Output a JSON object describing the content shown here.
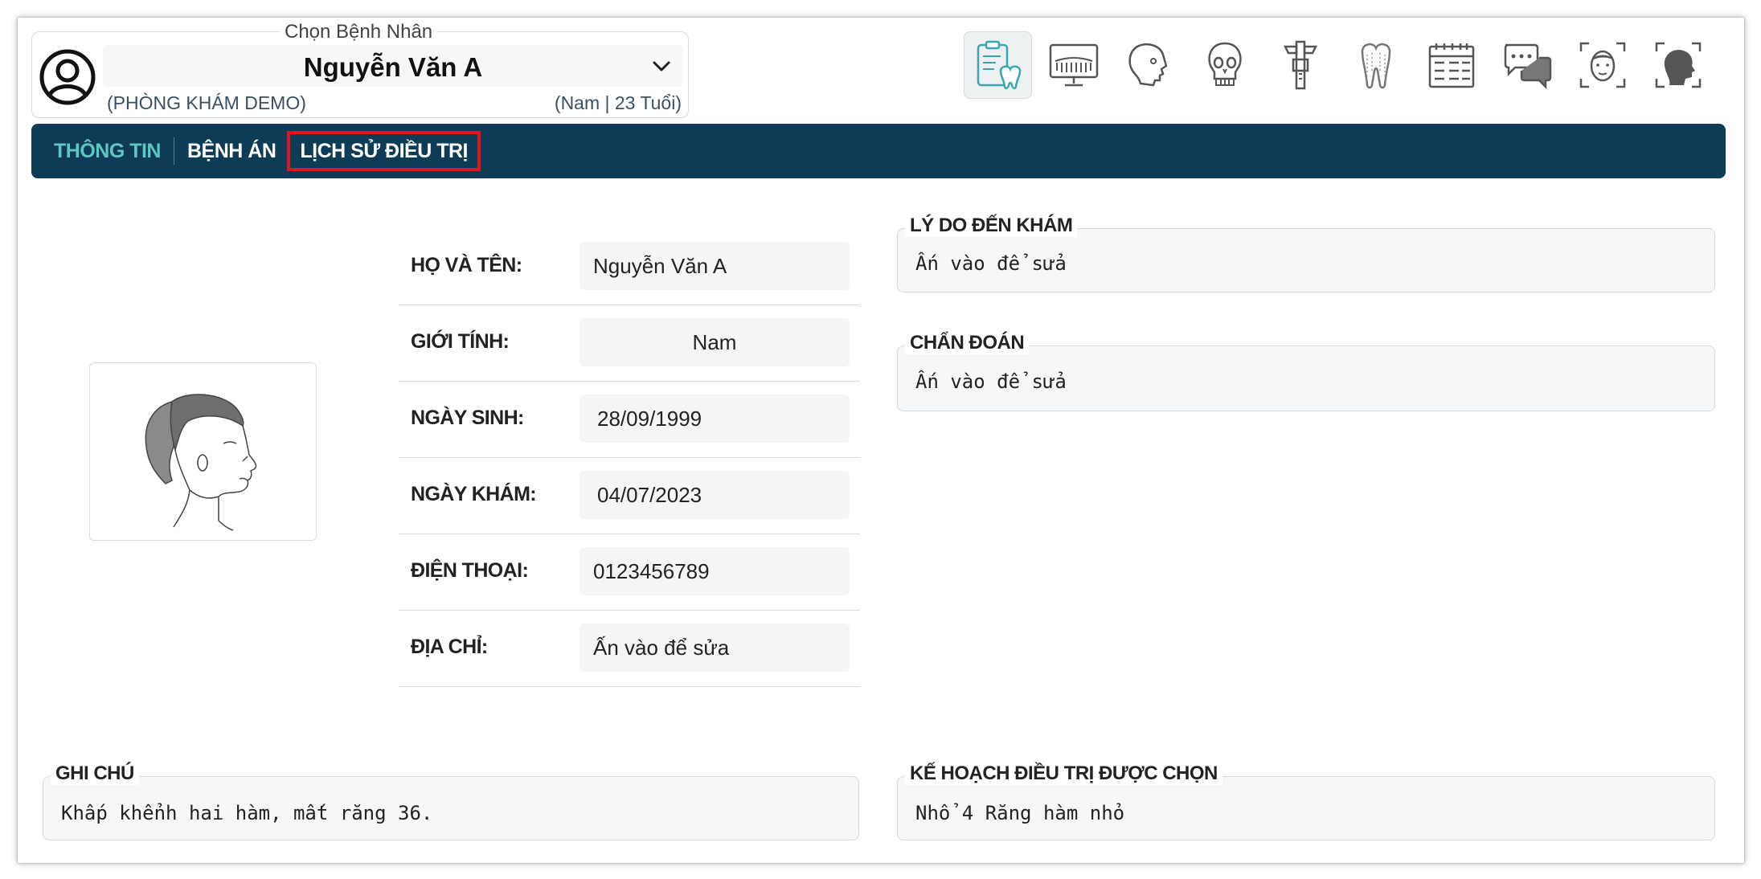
{
  "patient": {
    "legend": "Chọn Bệnh Nhân",
    "name": "Nguyễn Văn A",
    "clinic": "(PHÒNG KHÁM DEMO)",
    "meta": "(Nam | 23 Tuổi)"
  },
  "toolbar": {
    "tools": [
      {
        "icon": "clipboard-tooth-icon",
        "active": true
      },
      {
        "icon": "xray-monitor-icon",
        "active": false
      },
      {
        "icon": "skull-profile-icon",
        "active": false
      },
      {
        "icon": "skull-front-icon",
        "active": false
      },
      {
        "icon": "caliper-icon",
        "active": false
      },
      {
        "icon": "tooth-icon",
        "active": false
      },
      {
        "icon": "calendar-icon",
        "active": false
      },
      {
        "icon": "chat-icon",
        "active": false
      },
      {
        "icon": "face-scan-icon",
        "active": false
      },
      {
        "icon": "head-scan-icon",
        "active": false
      }
    ]
  },
  "tabs": {
    "info": "THÔNG TIN",
    "record": "BỆNH ÁN",
    "history": "LỊCH SỬ ĐIỀU TRỊ",
    "active": "info",
    "highlighted": "history",
    "colors": {
      "bar": "#0e3b56",
      "active": "#5fc7c3",
      "highlight": "#e3141b"
    }
  },
  "info": {
    "fullname_label": "HỌ VÀ TÊN:",
    "fullname": "Nguyễn Văn A",
    "gender_label": "GIỚI TÍNH:",
    "gender": "Nam",
    "dob_label": "NGÀY SINH:",
    "dob": "28/09/1999",
    "exam_date_label": "NGÀY KHÁM:",
    "exam_date": "04/07/2023",
    "phone_label": "ĐIỆN THOẠI:",
    "phone": "0123456789",
    "address_label": "ĐỊA CHỈ:",
    "address": "Ấn vào để sửa"
  },
  "reason": {
    "label": "LÝ DO ĐẾN KHÁM",
    "text": "Ấn vào để sửa"
  },
  "diagnosis": {
    "label": "CHẨN ĐOÁN",
    "text": "Ấn vào để sửa"
  },
  "notes": {
    "label": "GHI CHÚ",
    "text": "Khấp khểnh hai hàm, mất răng 36."
  },
  "plan": {
    "label": "KẾ HOẠCH ĐIỀU TRỊ ĐƯỢC CHỌN",
    "text": "Nhổ 4 Răng hàm nhỏ"
  }
}
